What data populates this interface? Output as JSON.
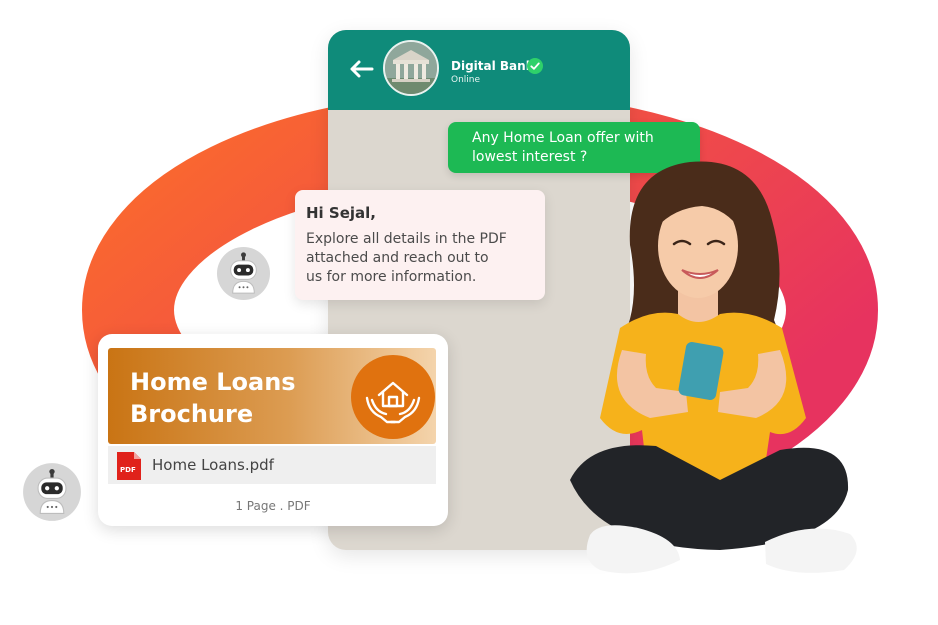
{
  "colors": {
    "ring_start": "#fb6b2c",
    "ring_end": "#e7335f",
    "chat_header": "#0f8b7a",
    "chat_bg": "#dcd7cf",
    "outgoing_bubble": "#1db954",
    "incoming_bubble": "#fdf1f1",
    "banner_orange": "#c97414",
    "pdf_red": "#e0221b"
  },
  "chat": {
    "contact_name": "Digital Bank",
    "contact_status": "Online",
    "verified_icon": "check-circle-icon",
    "back_icon": "arrow-left-icon",
    "outgoing_message": "Any Home Loan offer with\nlowest interest ?",
    "incoming_greeting": "Hi Sejal,",
    "incoming_message": "Explore all details in the PDF\nattached and reach out to\nus for more information."
  },
  "brochure": {
    "title": "Home Loans\nBrochure",
    "icon": "house-in-hands-icon",
    "file_icon": "pdf-icon",
    "file_label": "PDF",
    "file_name": "Home Loans.pdf",
    "file_meta": "1 Page . PDF"
  },
  "bots": {
    "icon": "robot-avatar-icon"
  }
}
